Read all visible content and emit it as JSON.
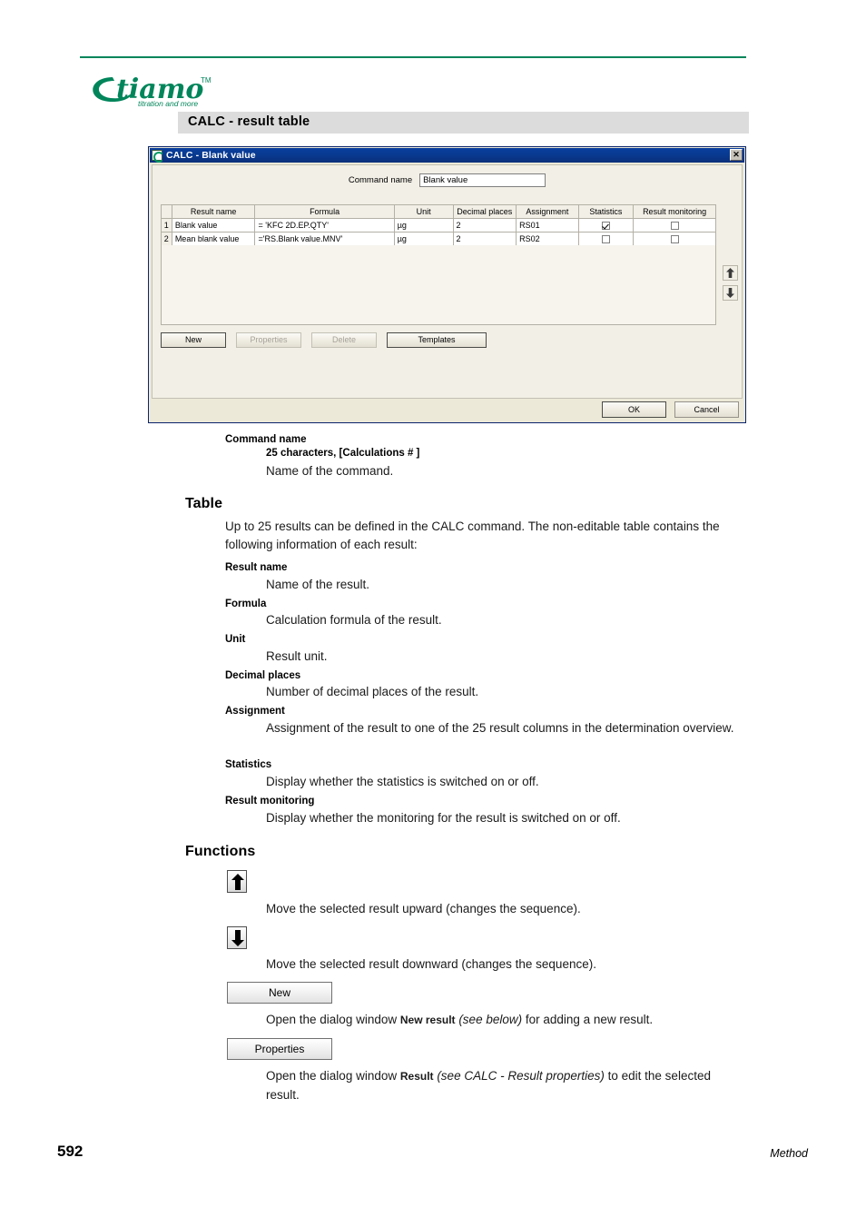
{
  "brand": {
    "name": "tiamo",
    "trademark": "TM",
    "tagline": "titration and more"
  },
  "section": {
    "title": "CALC - result table"
  },
  "dialog": {
    "title": "CALC - Blank value",
    "close_label": "✕",
    "command_name_label": "Command name",
    "command_name_value": "Blank value",
    "table": {
      "headers": [
        "Result name",
        "Formula",
        "Unit",
        "Decimal places",
        "Assignment",
        "Statistics",
        "Result monitoring"
      ],
      "rows": [
        {
          "num": "1",
          "name": "Blank value",
          "formula": "= 'KFC 2D.EP.QTY'",
          "unit": "µg",
          "decimals": "2",
          "assignment": "RS01",
          "statistics": true,
          "monitoring": false
        },
        {
          "num": "2",
          "name": "Mean blank value",
          "formula": "='RS.Blank value.MNV'",
          "unit": "µg",
          "decimals": "2",
          "assignment": "RS02",
          "statistics": false,
          "monitoring": false
        }
      ]
    },
    "buttons": {
      "new": "New",
      "properties": "Properties",
      "delete": "Delete",
      "templates": "Templates",
      "ok": "OK",
      "cancel": "Cancel"
    }
  },
  "doc": {
    "command_name": {
      "term": "Command name",
      "spec": "25 characters, [Calculations # ]",
      "text": "Name of the command."
    },
    "table_heading": "Table",
    "table_intro": "Up to 25 results can be defined in the CALC command. The non-editable table contains the following information of each result:",
    "entries": [
      {
        "term": "Result name",
        "text": "Name of the result."
      },
      {
        "term": "Formula",
        "text": "Calculation formula of the result."
      },
      {
        "term": "Unit",
        "text": "Result unit."
      },
      {
        "term": "Decimal places",
        "text": "Number of decimal places of the result."
      },
      {
        "term": "Assignment",
        "text": "Assignment of the result to one of the 25 result columns in the determination overview."
      },
      {
        "term": "Statistics",
        "text": "Display whether the statistics is switched on or off."
      },
      {
        "term": "Result monitoring",
        "text": "Display whether the monitoring for the result is switched on or off."
      }
    ],
    "functions_heading": "Functions",
    "functions": [
      {
        "icon": "arrow-up-icon",
        "text": "Move the selected result upward (changes the sequence)."
      },
      {
        "icon": "arrow-down-icon",
        "text": "Move the selected result downward (changes the sequence)."
      }
    ],
    "function_buttons": [
      {
        "label": "New",
        "text_before": "Open the dialog window ",
        "text_bold": "New result",
        "text_italic": "(see below)",
        "text_after": " for adding a new result."
      },
      {
        "label": "Properties",
        "text_before": "Open the dialog window ",
        "text_bold": "Result",
        "text_italic": "(see CALC - Result properties)",
        "text_after": " to edit the selected result."
      }
    ]
  },
  "footer": {
    "page_number": "592",
    "chapter": "Method"
  },
  "colors": {
    "brand_green": "#00855a",
    "title_blue": "#0a3f9e",
    "section_gray": "#dcdcdc"
  }
}
